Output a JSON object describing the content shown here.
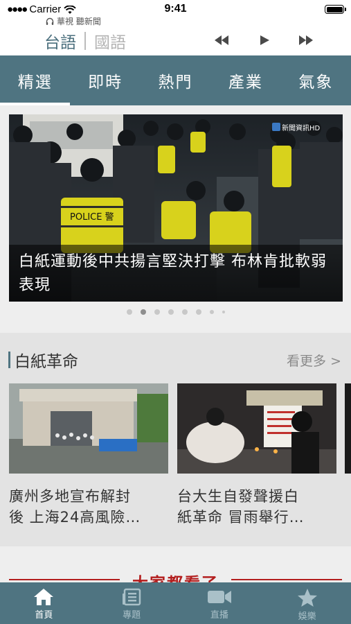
{
  "status": {
    "carrier": "Carrier",
    "time": "9:41"
  },
  "radio": {
    "title": "華視 聽新聞",
    "lang_active": "台語",
    "lang_inactive": "國語"
  },
  "tabs": [
    {
      "label": "精選"
    },
    {
      "label": "即時"
    },
    {
      "label": "熱門"
    },
    {
      "label": "產業"
    },
    {
      "label": "氣象"
    }
  ],
  "hero": {
    "caption": "白紙運動後中共揚言堅決打擊 布林肯批軟弱表現",
    "watermark": "新聞資訊HD",
    "vest_text": "POLICE 警"
  },
  "carousel": {
    "page_count": 8,
    "current_index": 1
  },
  "section": {
    "title": "白紙革命",
    "more_label": "看更多 >",
    "cards": [
      {
        "title": "廣州多地宣布解封\n後 上海24高風險…"
      },
      {
        "title": "台大生自發聲援白\n紙革命 冒雨舉行…"
      }
    ]
  },
  "next_section": {
    "title": "大家都看了"
  },
  "bottom_nav": [
    {
      "label": "首頁",
      "icon": "home-icon",
      "active": true
    },
    {
      "label": "專題",
      "icon": "newspaper-icon",
      "active": false
    },
    {
      "label": "直播",
      "icon": "video-camera-icon",
      "active": false
    },
    {
      "label": "娛樂",
      "icon": "star-icon",
      "active": false
    }
  ],
  "colors": {
    "brand": "#4f7481",
    "accent_red": "#b31e1e"
  }
}
